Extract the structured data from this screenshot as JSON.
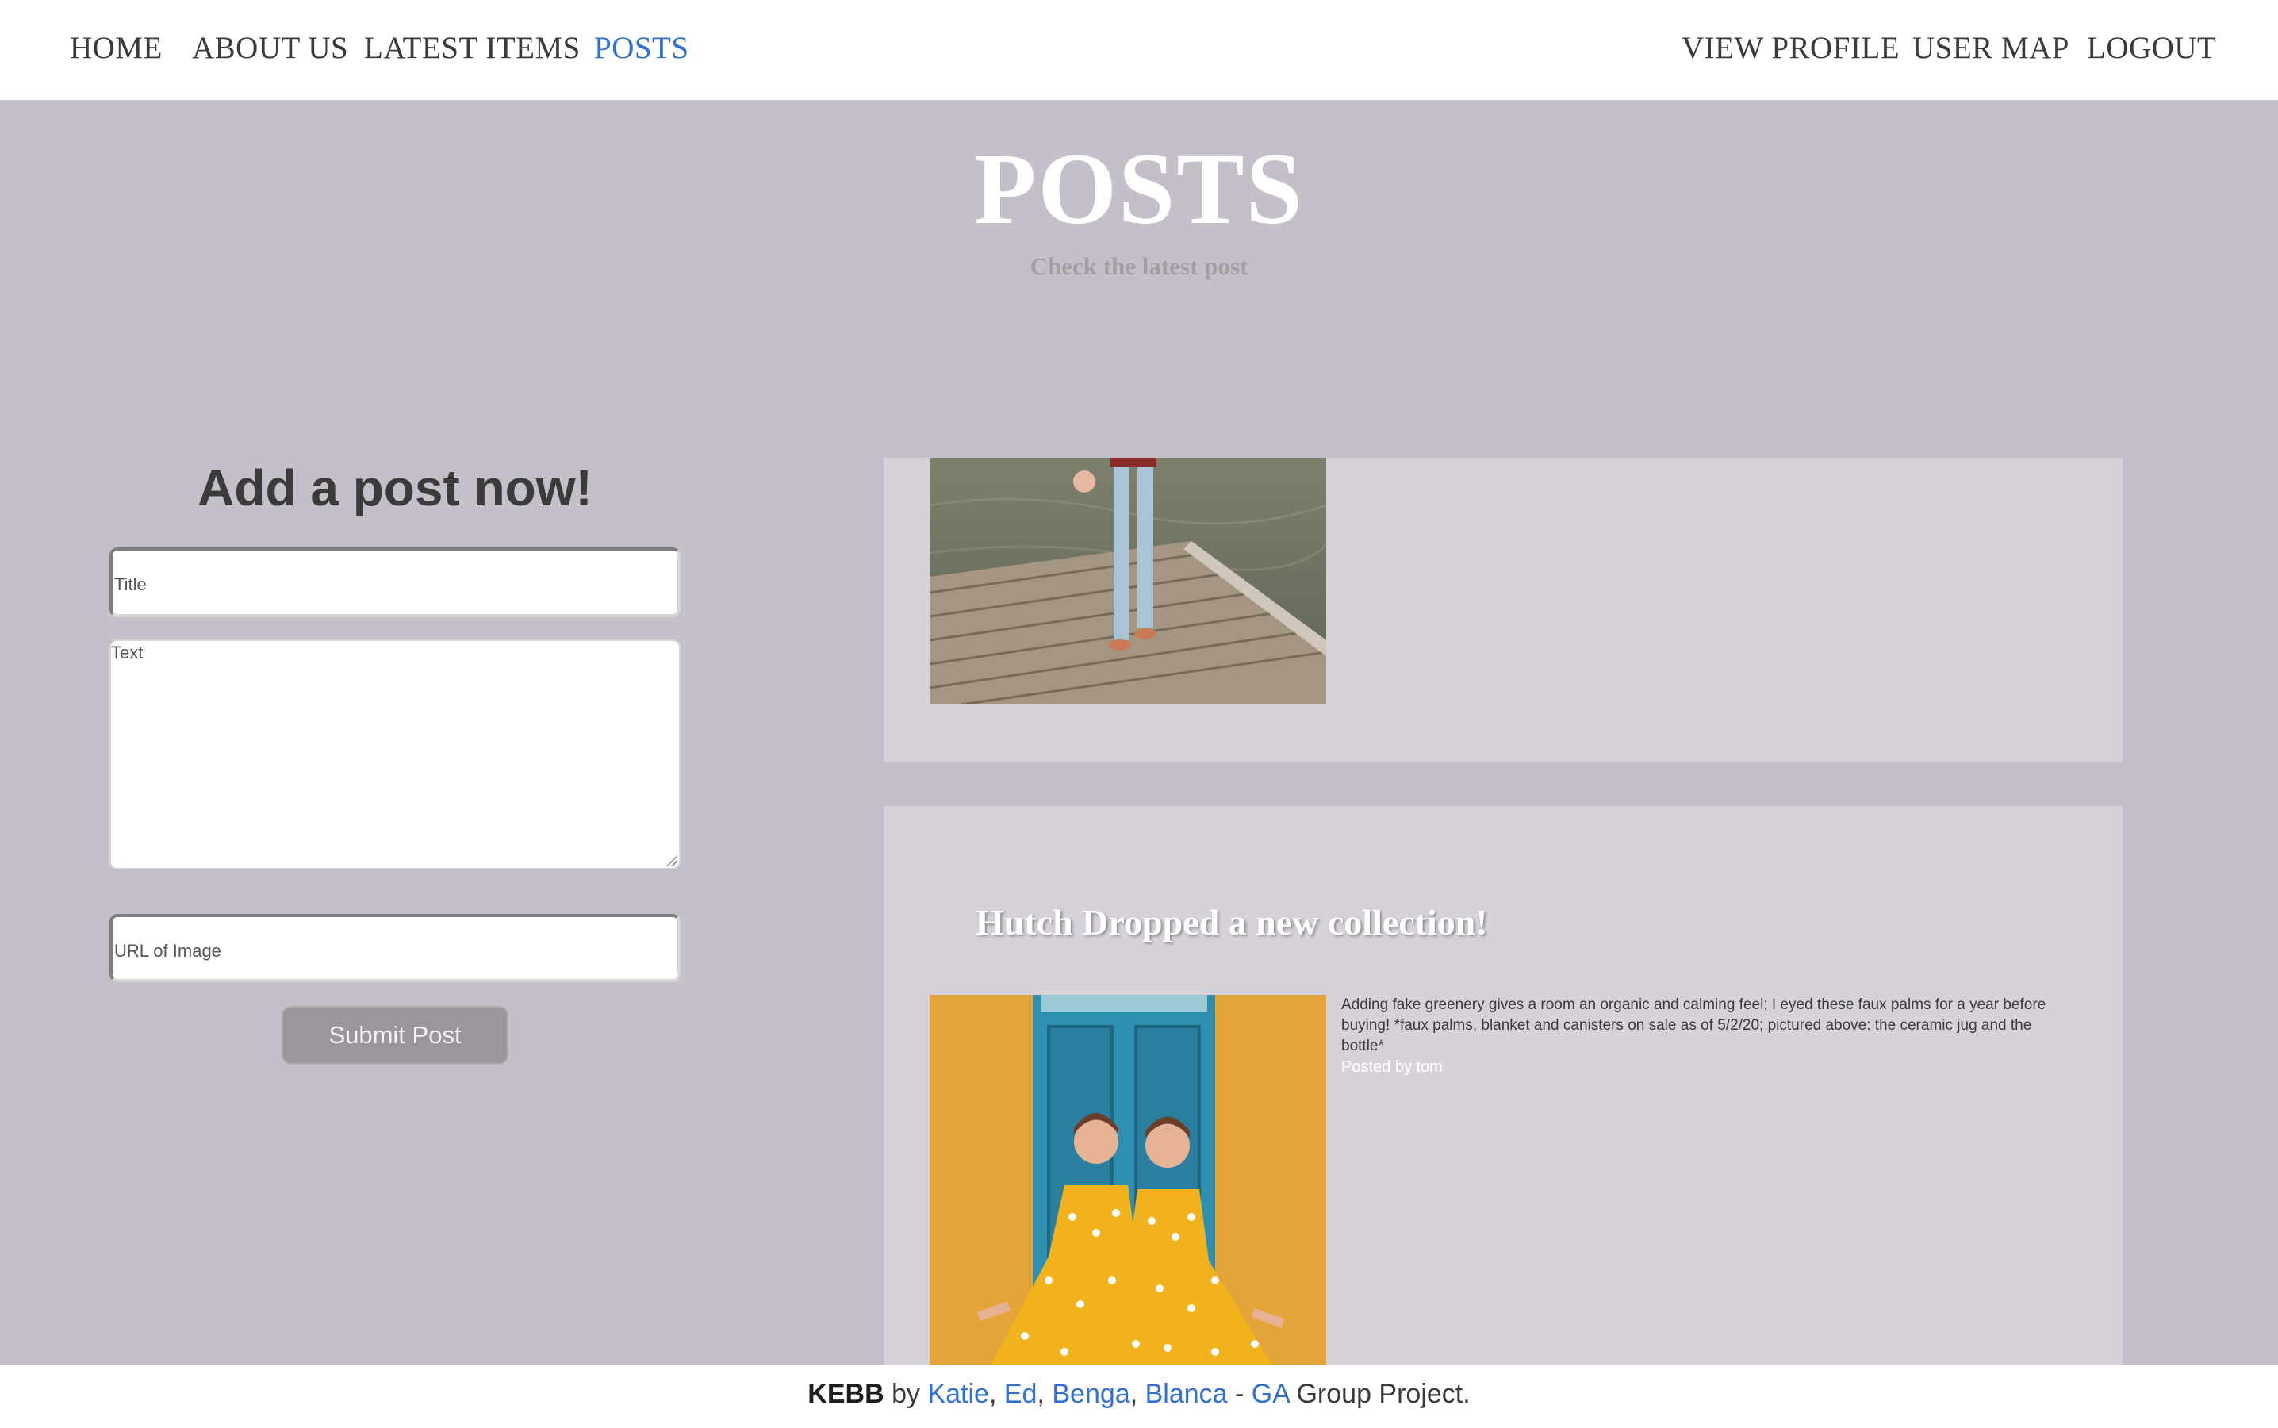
{
  "nav": {
    "left": [
      {
        "label": "HOME"
      },
      {
        "label": "ABOUT US"
      },
      {
        "label": "LATEST ITEMS"
      },
      {
        "label": "POSTS",
        "active": true
      }
    ],
    "right": [
      {
        "label": "VIEW PROFILE"
      },
      {
        "label": "USER MAP"
      },
      {
        "label": "LOGOUT"
      }
    ],
    "active_color": "#2f6fd6"
  },
  "hero": {
    "title": "POSTS",
    "subtitle": "Check the latest post"
  },
  "form": {
    "heading": "Add a post now!",
    "title_placeholder": "Title",
    "text_placeholder": "Text",
    "url_placeholder": "URL of Image",
    "submit_label": "Submit Post"
  },
  "posts": [
    {
      "image": "person-on-dock-photo"
    },
    {
      "title": "Hutch Dropped a new collection!",
      "image": "twins-yellow-dresses-photo",
      "text": "Adding fake greenery gives a room an organic and calming feel; I eyed these faux palms for a year before buying! *faux palms, blanket and canisters on sale as of 5/2/20; pictured above: the ceramic jug and the bottle*",
      "author": "Posted by tom"
    }
  ],
  "footer": {
    "brand": "KEBB",
    "by": " by ",
    "names": [
      "Katie",
      "Ed",
      "Benga",
      "Blanca"
    ],
    "sep1": ", ",
    "dash": " - ",
    "org": "GA",
    "suffix": " Group Project."
  },
  "colors": {
    "page_bg": "#c4bfc8",
    "card_bg": "#d7d2da",
    "link": "#2f6fd6",
    "button_bg": "#9c959b"
  }
}
